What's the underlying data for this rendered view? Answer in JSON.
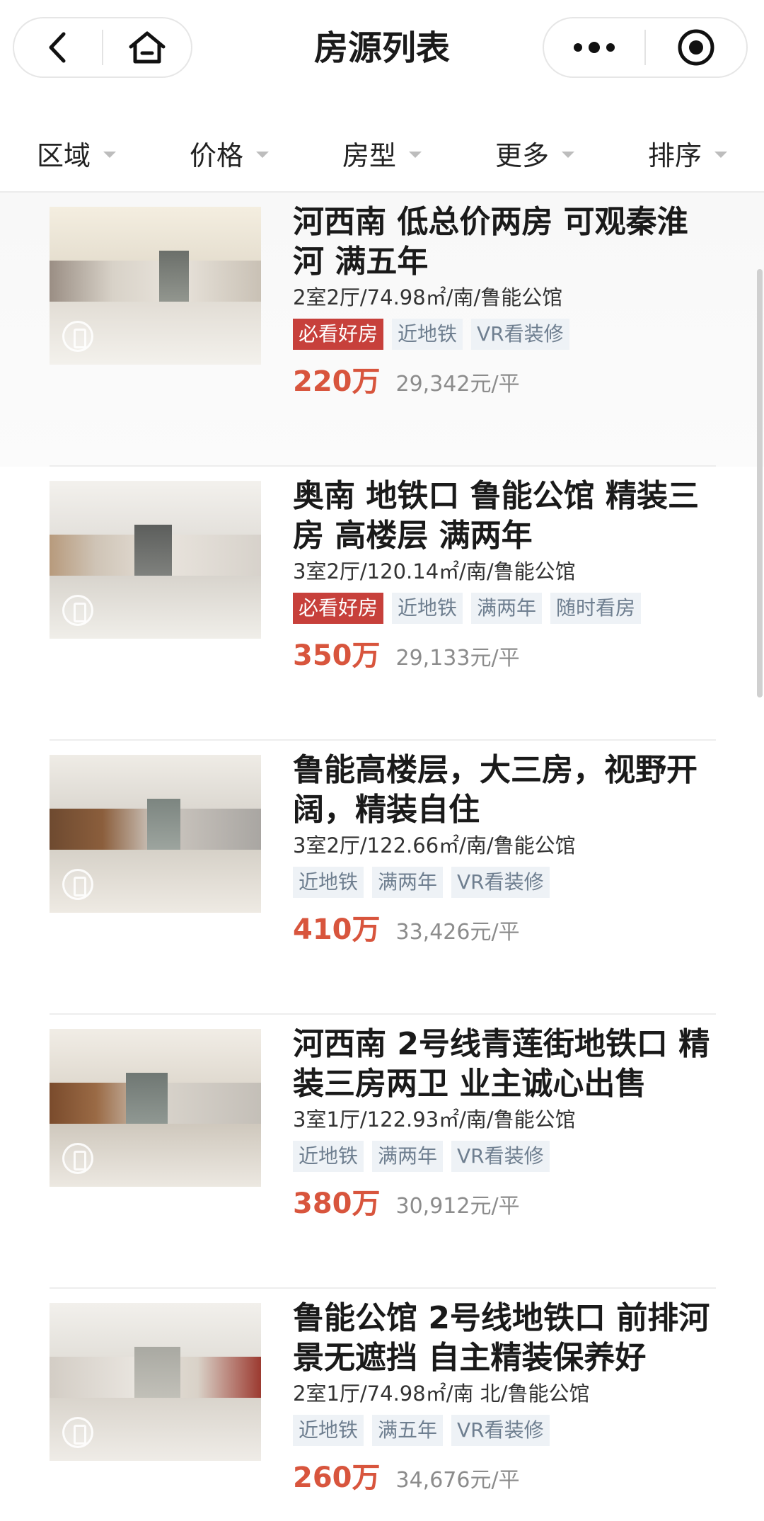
{
  "header": {
    "title": "房源列表",
    "back_icon": "chevron-left-icon",
    "home_icon": "home-icon",
    "more_icon": "more-dots-icon",
    "close_icon": "target-circle-icon"
  },
  "filters": [
    {
      "label": "区域"
    },
    {
      "label": "价格"
    },
    {
      "label": "房型"
    },
    {
      "label": "更多"
    },
    {
      "label": "排序"
    }
  ],
  "listings": [
    {
      "title": "河西南 低总价两房 可观秦淮河 满五年",
      "meta": "2室2厅/74.98㎡/南/鲁能公馆",
      "tags": [
        "必看好房",
        "近地铁",
        "VR看装修"
      ],
      "price": "220万",
      "unit_price": "29,342元/平"
    },
    {
      "title": "奥南 地铁口 鲁能公馆 精装三房 高楼层 满两年",
      "meta": "3室2厅/120.14㎡/南/鲁能公馆",
      "tags": [
        "必看好房",
        "近地铁",
        "满两年",
        "随时看房"
      ],
      "price": "350万",
      "unit_price": "29,133元/平"
    },
    {
      "title": "鲁能高楼层，大三房，视野开阔，精装自住",
      "meta": "3室2厅/122.66㎡/南/鲁能公馆",
      "tags": [
        "近地铁",
        "满两年",
        "VR看装修"
      ],
      "price": "410万",
      "unit_price": "33,426元/平"
    },
    {
      "title": "河西南 2号线青莲街地铁口 精装三房两卫 业主诚心出售",
      "meta": "3室1厅/122.93㎡/南/鲁能公馆",
      "tags": [
        "近地铁",
        "满两年",
        "VR看装修"
      ],
      "price": "380万",
      "unit_price": "30,912元/平"
    },
    {
      "title": "鲁能公馆 2号线地铁口 前排河景无遮挡 自主精装保养好",
      "meta": "2室1厅/74.98㎡/南 北/鲁能公馆",
      "tags": [
        "近地铁",
        "满五年",
        "VR看装修"
      ],
      "price": "260万",
      "unit_price": "34,676元/平"
    }
  ],
  "colors": {
    "price": "#d8553d",
    "hot_tag": "#c7403b",
    "tag_bg": "#eef2f6",
    "tag_text": "#6f7f90"
  }
}
